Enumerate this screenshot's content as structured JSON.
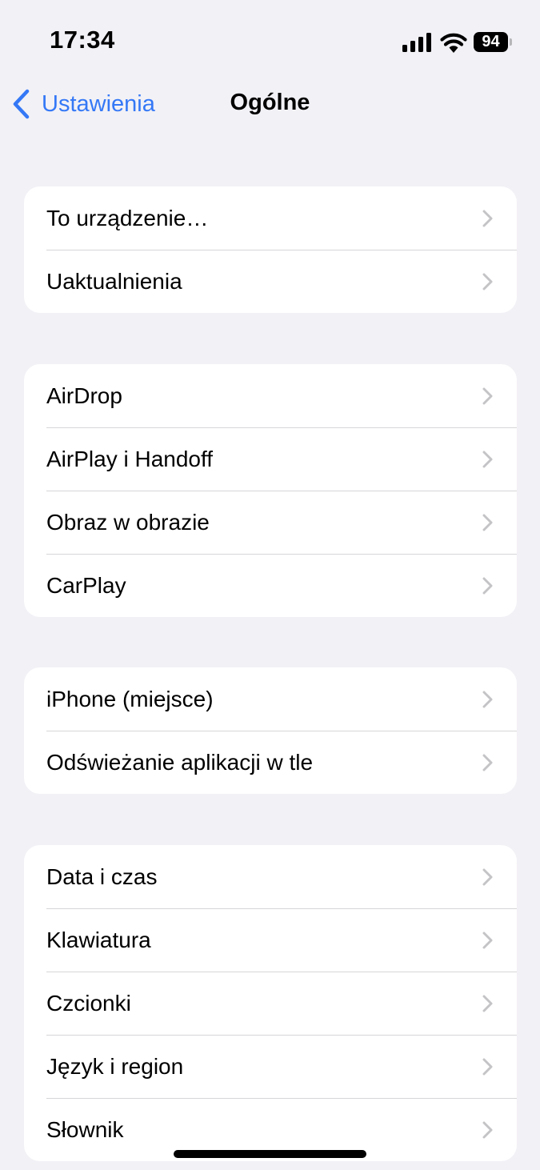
{
  "status_bar": {
    "time": "17:34",
    "battery_level": "94",
    "icons": [
      "signal-icon",
      "wifi-icon",
      "battery-icon"
    ]
  },
  "nav": {
    "back_label": "Ustawienia",
    "title": "Ogólne"
  },
  "colors": {
    "accent": "#3478f6",
    "background": "#f2f1f6",
    "card": "#ffffff",
    "separator": "#d6d6d9",
    "chevron": "#c4c4c7"
  },
  "groups": [
    {
      "items": [
        {
          "label": "To urządzenie…"
        },
        {
          "label": "Uaktualnienia"
        }
      ]
    },
    {
      "items": [
        {
          "label": "AirDrop"
        },
        {
          "label": "AirPlay i Handoff"
        },
        {
          "label": "Obraz w obrazie"
        },
        {
          "label": "CarPlay"
        }
      ]
    },
    {
      "items": [
        {
          "label": "iPhone (miejsce)"
        },
        {
          "label": "Odświeżanie aplikacji w tle"
        }
      ]
    },
    {
      "items": [
        {
          "label": "Data i czas"
        },
        {
          "label": "Klawiatura"
        },
        {
          "label": "Czcionki"
        },
        {
          "label": "Język i region"
        },
        {
          "label": "Słownik"
        }
      ]
    }
  ]
}
